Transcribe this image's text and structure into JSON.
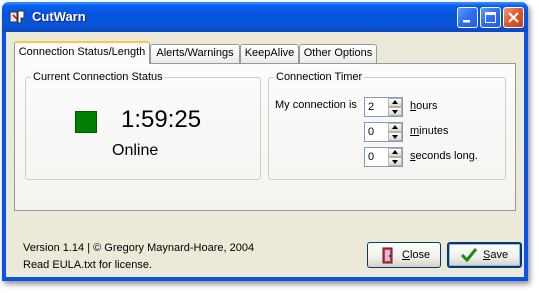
{
  "window": {
    "title": "CutWarn",
    "controls": {
      "minimize": "minimize-icon",
      "maximize": "maximize-icon",
      "close": "close-icon"
    }
  },
  "tabs": [
    {
      "label": "Connection Status/Length",
      "active": true
    },
    {
      "label": "Alerts/Warnings",
      "active": false
    },
    {
      "label": "KeepAlive",
      "active": false
    },
    {
      "label": "Other Options",
      "active": false
    }
  ],
  "status_group": {
    "title": "Current Connection Status",
    "time": "1:59:25",
    "state": "Online",
    "indicator_color": "#008000"
  },
  "timer_group": {
    "title": "Connection Timer",
    "prefix": "My connection is",
    "hours": {
      "value": "2",
      "unit": "hours",
      "hotkey": "h",
      "rest": "ours"
    },
    "minutes": {
      "value": "0",
      "unit": "minutes",
      "hotkey": "m",
      "rest": "inutes"
    },
    "seconds": {
      "value": "0",
      "unit": "seconds long.",
      "hotkey": "s",
      "rest": "econds long."
    }
  },
  "footer": {
    "version": "Version 1.14 | © Gregory Maynard-Hoare, 2004",
    "license": "Read EULA.txt for license."
  },
  "buttons": {
    "close": {
      "label": "Close",
      "hotkey": "C",
      "rest": "lose"
    },
    "save": {
      "label": "Save",
      "hotkey": "S",
      "rest": "ave"
    }
  }
}
